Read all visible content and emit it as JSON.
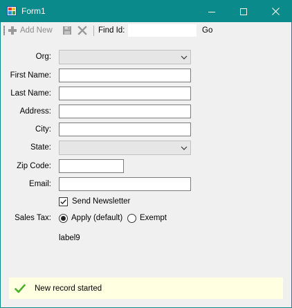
{
  "window": {
    "title": "Form1"
  },
  "toolbar": {
    "add_new_label": "Add New",
    "find_label": "Find Id:",
    "find_value": "",
    "go_label": "Go"
  },
  "form": {
    "org_label": "Org:",
    "first_name_label": "First Name:",
    "last_name_label": "Last Name:",
    "address_label": "Address:",
    "city_label": "City:",
    "state_label": "State:",
    "zip_label": "Zip Code:",
    "email_label": "Email:",
    "org_value": "",
    "first_name_value": "",
    "last_name_value": "",
    "address_value": "",
    "city_value": "",
    "state_value": "",
    "zip_value": "",
    "email_value": "",
    "newsletter_label": "Send Newsletter",
    "newsletter_checked": true,
    "sales_tax_label": "Sales Tax:",
    "apply_label": "Apply (default)",
    "exempt_label": "Exempt",
    "sales_tax_selected": "Apply (default)",
    "label9": "label9"
  },
  "status": {
    "message": "New record started"
  },
  "colors": {
    "titlebar": "#0a8a8a",
    "status_bg": "#ffffe1",
    "check_green": "#4caf2a"
  }
}
